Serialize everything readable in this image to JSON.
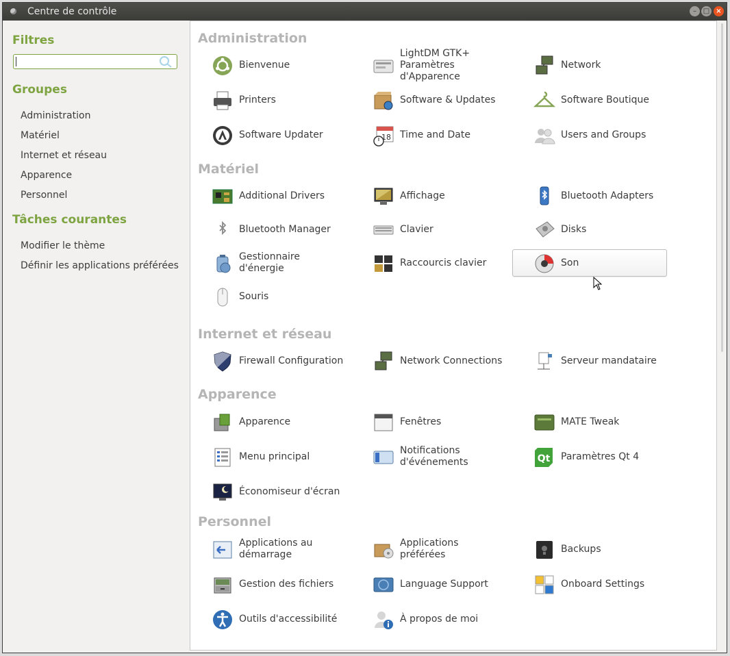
{
  "window": {
    "title": "Centre de contrôle"
  },
  "sidebar": {
    "filters_heading": "Filtres",
    "search_value": "",
    "groups_heading": "Groupes",
    "groups": [
      "Administration",
      "Matériel",
      "Internet et réseau",
      "Apparence",
      "Personnel"
    ],
    "tasks_heading": "Tâches courantes",
    "tasks": [
      "Modifier le thème",
      "Définir les applications préférées"
    ]
  },
  "sections": [
    {
      "title": "Administration",
      "items": [
        {
          "label": "Bienvenue",
          "icon": "welcome-icon"
        },
        {
          "label": "LightDM GTK+\nParamètres d'Apparence",
          "icon": "lightdm-icon"
        },
        {
          "label": "Network",
          "icon": "network-icon"
        },
        {
          "label": "Printers",
          "icon": "printer-icon"
        },
        {
          "label": "Software & Updates",
          "icon": "software-sources-icon"
        },
        {
          "label": "Software Boutique",
          "icon": "boutique-icon"
        },
        {
          "label": "Software Updater",
          "icon": "updater-icon"
        },
        {
          "label": "Time and Date",
          "icon": "calendar-icon"
        },
        {
          "label": "Users and Groups",
          "icon": "users-icon"
        }
      ]
    },
    {
      "title": "Matériel",
      "items": [
        {
          "label": "Additional Drivers",
          "icon": "drivers-icon"
        },
        {
          "label": "Affichage",
          "icon": "display-icon"
        },
        {
          "label": "Bluetooth Adapters",
          "icon": "bluetooth-adapter-icon"
        },
        {
          "label": "Bluetooth Manager",
          "icon": "bluetooth-icon"
        },
        {
          "label": "Clavier",
          "icon": "keyboard-icon"
        },
        {
          "label": "Disks",
          "icon": "disks-icon"
        },
        {
          "label": "Gestionnaire d'énergie",
          "icon": "power-icon"
        },
        {
          "label": "Raccourcis clavier",
          "icon": "shortcuts-icon"
        },
        {
          "label": "Son",
          "icon": "sound-icon"
        },
        {
          "label": "Souris",
          "icon": "mouse-icon"
        }
      ]
    },
    {
      "title": "Internet et réseau",
      "items": [
        {
          "label": "Firewall Configuration",
          "icon": "firewall-icon"
        },
        {
          "label": "Network Connections",
          "icon": "network-connections-icon"
        },
        {
          "label": "Serveur mandataire",
          "icon": "proxy-icon"
        }
      ]
    },
    {
      "title": "Apparence",
      "items": [
        {
          "label": "Apparence",
          "icon": "appearance-icon"
        },
        {
          "label": "Fenêtres",
          "icon": "windows-icon"
        },
        {
          "label": "MATE Tweak",
          "icon": "mate-tweak-icon"
        },
        {
          "label": "Menu principal",
          "icon": "main-menu-icon"
        },
        {
          "label": "Notifications\nd'événements",
          "icon": "notifications-icon"
        },
        {
          "label": "Paramètres Qt 4",
          "icon": "qt-icon"
        },
        {
          "label": "Économiseur d'écran",
          "icon": "screensaver-icon"
        }
      ]
    },
    {
      "title": "Personnel",
      "items": [
        {
          "label": "Applications au\ndémarrage",
          "icon": "startup-icon"
        },
        {
          "label": "Applications préférées",
          "icon": "preferred-apps-icon"
        },
        {
          "label": "Backups",
          "icon": "backups-icon"
        },
        {
          "label": "Gestion des fichiers",
          "icon": "file-manager-icon"
        },
        {
          "label": "Language Support",
          "icon": "language-icon"
        },
        {
          "label": "Onboard Settings",
          "icon": "onboard-icon"
        },
        {
          "label": "Outils d'accessibilité",
          "icon": "accessibility-icon"
        },
        {
          "label": "À propos de moi",
          "icon": "about-me-icon"
        }
      ]
    }
  ],
  "hovered_item": "Son"
}
